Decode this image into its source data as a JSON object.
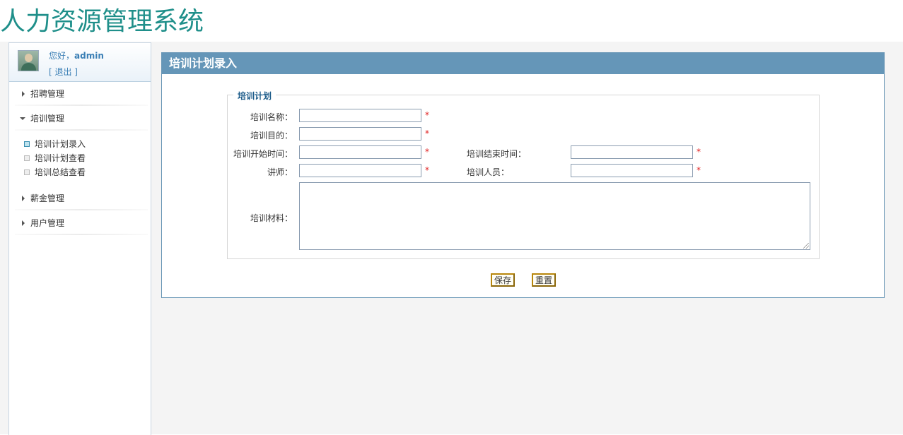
{
  "app": {
    "title": "人力资源管理系统"
  },
  "user": {
    "greeting": "您好，",
    "name": "admin",
    "logout": "[ 退出 ]"
  },
  "sidebar": {
    "groups": [
      {
        "label": "招聘管理"
      },
      {
        "label": "培训管理"
      },
      {
        "label": "薪金管理"
      },
      {
        "label": "用户管理"
      }
    ],
    "training_items": [
      {
        "label": "培训计划录入"
      },
      {
        "label": "培训计划查看"
      },
      {
        "label": "培训总结查看"
      }
    ]
  },
  "panel": {
    "title": "培训计划录入"
  },
  "form": {
    "legend": "培训计划",
    "required_mark": "*",
    "fields": {
      "name": {
        "label": "培训名称：",
        "value": ""
      },
      "goal": {
        "label": "培训目的：",
        "value": ""
      },
      "start_time": {
        "label": "培训开始时间：",
        "value": ""
      },
      "end_time": {
        "label": "培训结束时间：",
        "value": ""
      },
      "teacher": {
        "label": "讲师：",
        "value": ""
      },
      "staff": {
        "label": "培训人员：",
        "value": ""
      },
      "material": {
        "label": "培训材料：",
        "value": ""
      }
    },
    "buttons": {
      "save": "保存",
      "reset": "重置"
    }
  },
  "colors": {
    "title": "#1f8f8a",
    "panel_header": "#6596b8",
    "link": "#3b7fb5",
    "required": "#e02020",
    "button_border": "#b8860b"
  }
}
